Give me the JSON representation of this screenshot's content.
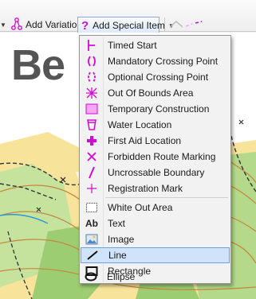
{
  "toolbar": {
    "add_variation_label": "Add Variation",
    "add_special_item_label": "Add Special Item"
  },
  "map": {
    "title_fragment": "Be"
  },
  "menu": {
    "items": [
      {
        "label": "Timed Start",
        "icon": "timed-start-icon"
      },
      {
        "label": "Mandatory Crossing Point",
        "icon": "mandatory-crossing-icon"
      },
      {
        "label": "Optional Crossing Point",
        "icon": "optional-crossing-icon"
      },
      {
        "label": "Out Of Bounds Area",
        "icon": "out-of-bounds-icon"
      },
      {
        "label": "Temporary Construction",
        "icon": "temporary-construction-icon"
      },
      {
        "label": "Water Location",
        "icon": "water-cup-icon"
      },
      {
        "label": "First Aid Location",
        "icon": "first-aid-cross-icon"
      },
      {
        "label": "Forbidden Route Marking",
        "icon": "forbidden-x-icon"
      },
      {
        "label": "Uncrossable Boundary",
        "icon": "uncrossable-boundary-icon"
      },
      {
        "label": "Registration Mark",
        "icon": "registration-mark-icon"
      },
      {
        "label": "White Out Area",
        "icon": "white-out-icon"
      },
      {
        "label": "Text",
        "icon": "text-ab-icon"
      },
      {
        "label": "Image",
        "icon": "image-icon"
      },
      {
        "label": "Line",
        "icon": "line-icon",
        "selected": true
      },
      {
        "label": "Rectangle",
        "icon": "rectangle-icon"
      },
      {
        "label": "Ellipse",
        "icon": "ellipse-icon"
      }
    ]
  },
  "colors": {
    "magenta": "#d40ad4",
    "selection_bg": "#cfe3fb",
    "selection_border": "#6f9fde"
  }
}
